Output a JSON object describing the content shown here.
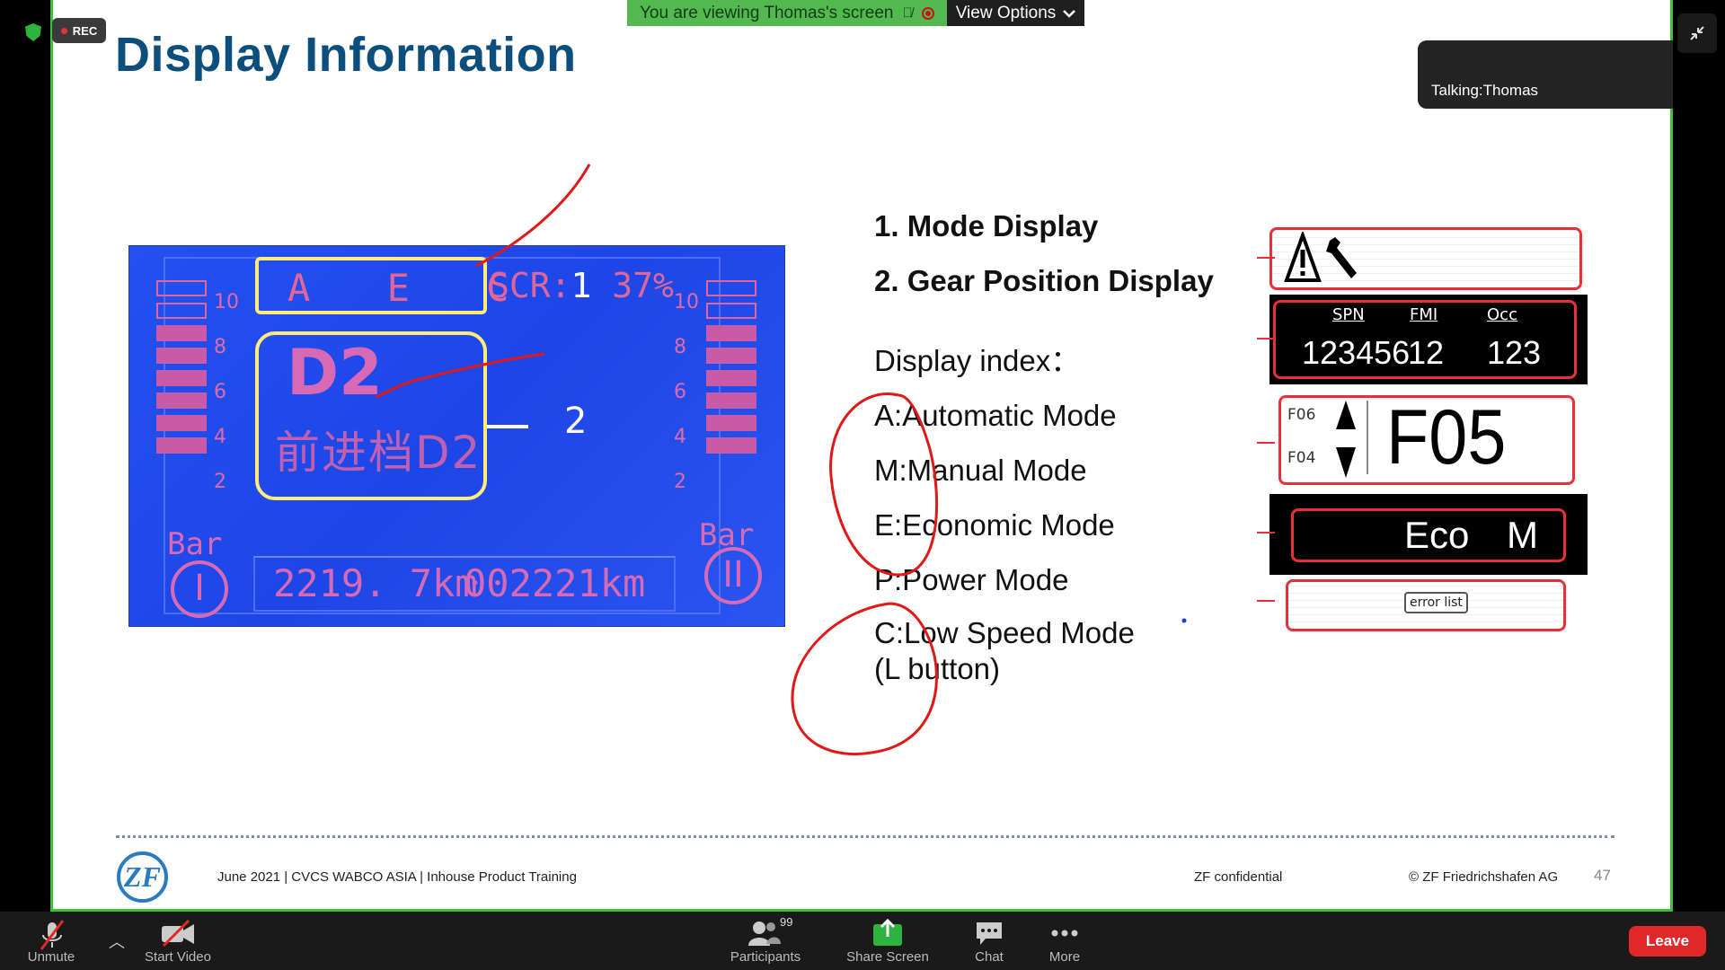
{
  "zoom": {
    "viewing_text": "You are viewing Thomas's screen",
    "view_options_label": "View Options",
    "rec_label": "REC",
    "talking_label": "Talking:Thomas",
    "toolbar": {
      "unmute": "Unmute",
      "start_video": "Start Video",
      "participants": "Participants",
      "participants_count": "99",
      "share_screen": "Share Screen",
      "chat": "Chat",
      "more": "More",
      "leave": "Leave"
    }
  },
  "slide": {
    "title": "Display Information",
    "lcd": {
      "mode_letters": "A E C",
      "scr_label": "SCR:",
      "scr_value": "37%",
      "callout_1": "1",
      "callout_2": "2",
      "gear": "D2",
      "gear_sub": "前进档D2",
      "left_ticks": [
        "10",
        "8",
        "6",
        "4",
        "2"
      ],
      "right_ticks": [
        "10",
        "8",
        "6",
        "4",
        "2"
      ],
      "bar_label_left": "Bar",
      "bar_label_right": "Bar",
      "circle_left": "I",
      "circle_right": "II",
      "odo_trip": "2219. 7km",
      "odo_total": "002221km"
    },
    "list": {
      "heading_1": "1. Mode Display",
      "heading_2": "2. Gear Position Display",
      "index_title": "Display index：",
      "items": [
        "A:Automatic Mode",
        "M:Manual Mode",
        "E:Economic Mode",
        "P:Power Mode",
        "C:Low Speed Mode"
      ],
      "item_extra": "(L button)"
    },
    "diagram": {
      "spn_label": "SPN",
      "fmi_label": "FMI",
      "occ_label": "Occ",
      "spn_value": "123456",
      "fmi_value": "12",
      "occ_value": "123",
      "gear_up": "F06",
      "gear_down": "F04",
      "gear_current": "F05",
      "mode_eco": "Eco",
      "mode_m": "M",
      "error_list": "error list"
    },
    "footer": {
      "left_text": "June 2021 | CVCS WABCO ASIA | Inhouse Product Training",
      "confidential": "ZF confidential",
      "copyright": "© ZF Friedrichshafen AG",
      "page": "47",
      "logo_text": "ZF"
    }
  }
}
